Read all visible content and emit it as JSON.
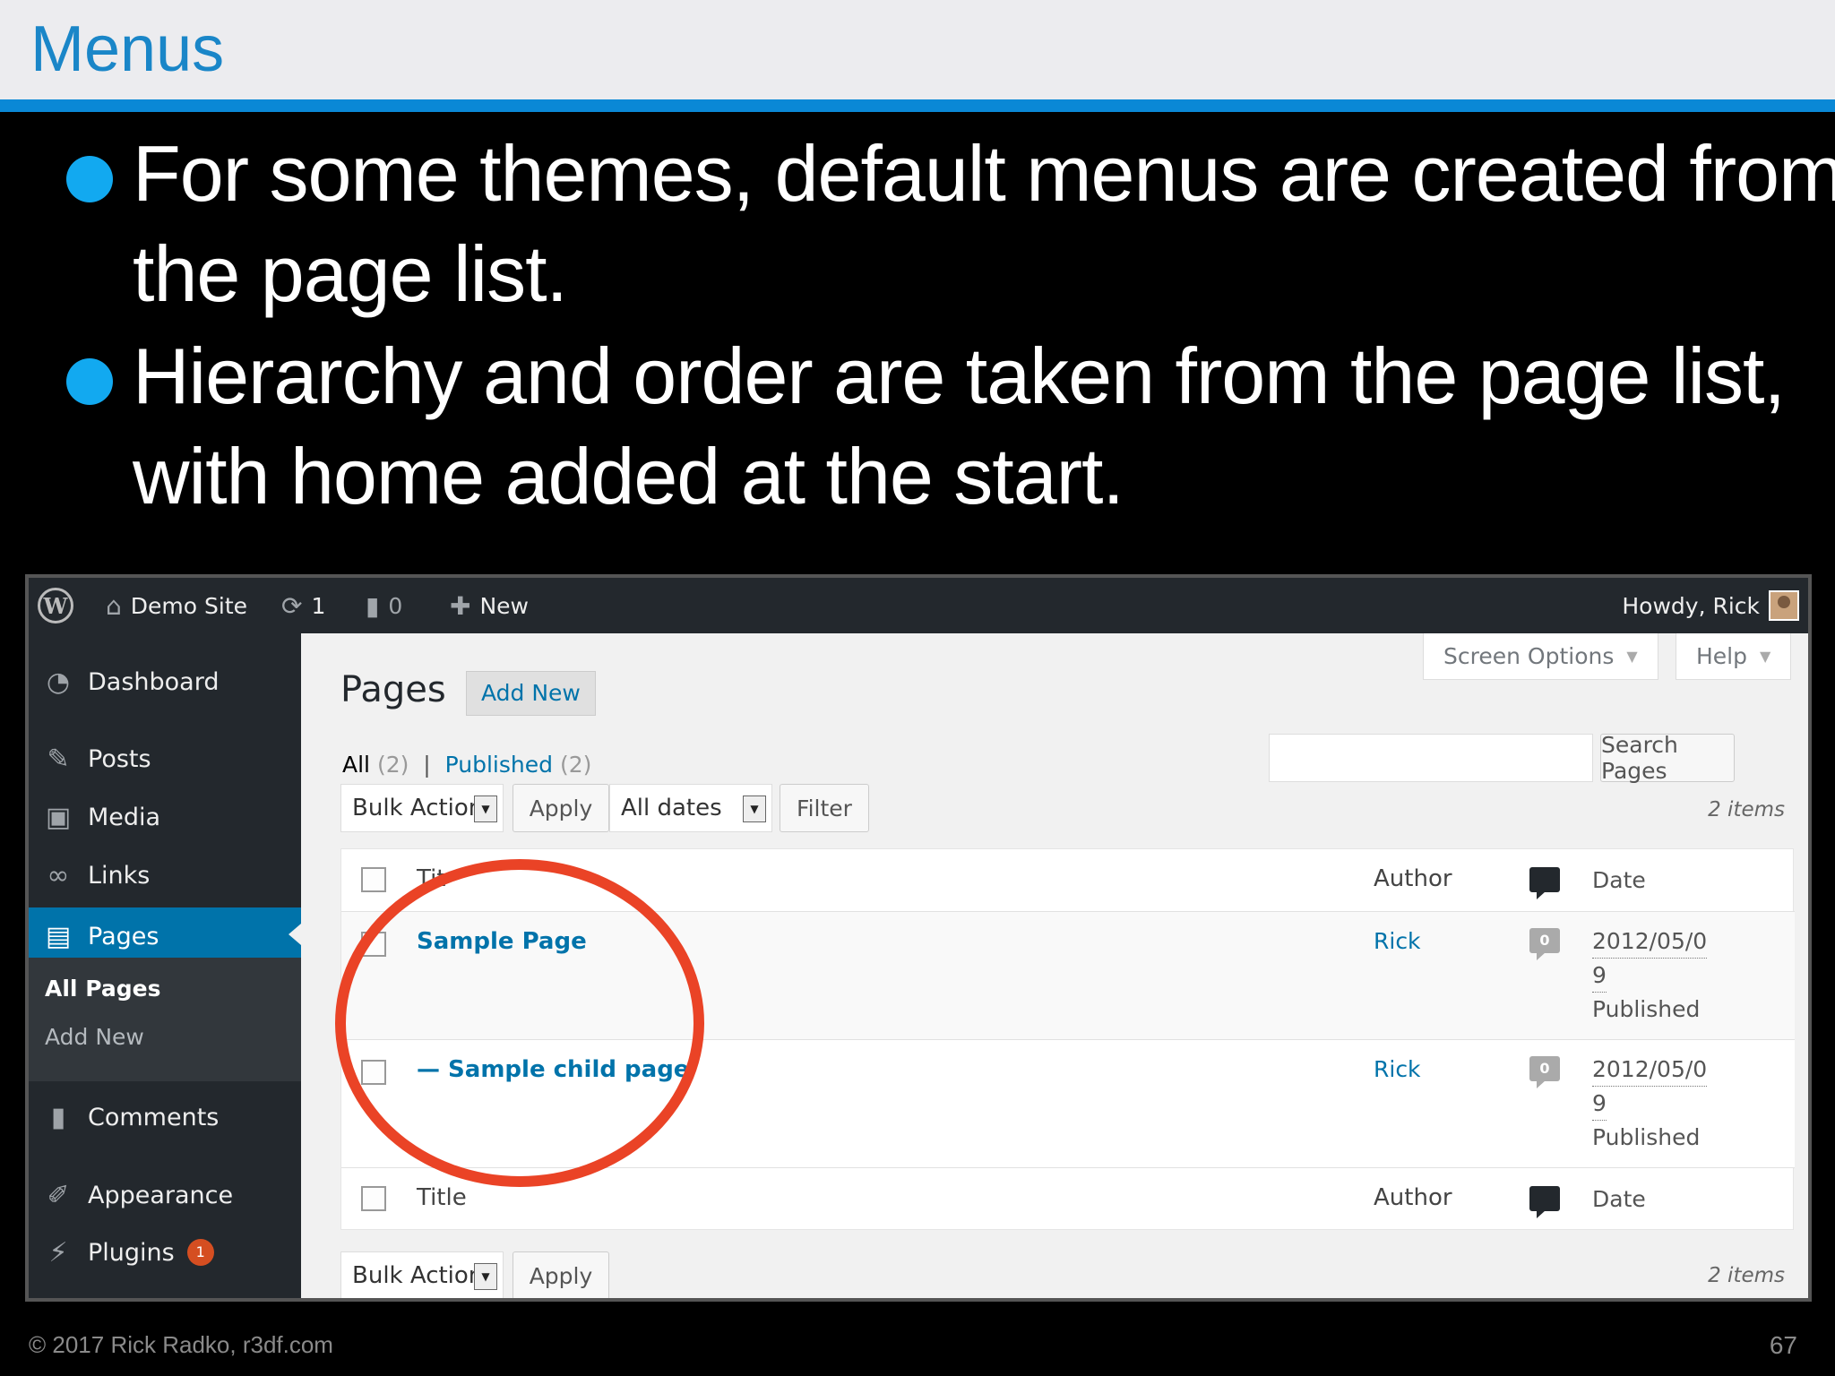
{
  "slide": {
    "title": "Menus",
    "bullets": [
      "For some themes, default menus are created from the page list.",
      "Hierarchy and order are taken from the page list, with home added at the start."
    ],
    "footer_left": "© 2017 Rick Radko, r3df.com",
    "page_number": "67",
    "accent_color": "#0a88d6",
    "bullet_color": "#12a9f0",
    "annotation_color": "#ea4326"
  },
  "adminbar": {
    "site_name": "Demo Site",
    "updates_count": "1",
    "comments_count": "0",
    "new_label": "New",
    "howdy": "Howdy, Rick",
    "icons": [
      "wordpress-icon",
      "home-icon",
      "update-icon",
      "comment-icon",
      "plus-icon"
    ]
  },
  "sidebar": {
    "items": [
      {
        "label": "Dashboard",
        "icon": "dashboard-icon"
      },
      {
        "label": "Posts",
        "icon": "pin-icon"
      },
      {
        "label": "Media",
        "icon": "media-icon"
      },
      {
        "label": "Links",
        "icon": "link-icon"
      },
      {
        "label": "Pages",
        "icon": "pages-icon",
        "current": true
      },
      {
        "label": "Comments",
        "icon": "comment-icon"
      },
      {
        "label": "Appearance",
        "icon": "brush-icon"
      },
      {
        "label": "Plugins",
        "icon": "plugin-icon",
        "badge": "1"
      }
    ],
    "submenu": [
      "All Pages",
      "Add New"
    ]
  },
  "main": {
    "title": "Pages",
    "add_new": "Add New",
    "screen_options": "Screen Options",
    "help": "Help",
    "filters": {
      "all_label": "All",
      "all_count": "(2)",
      "separator": "|",
      "published_label": "Published",
      "published_count": "(2)"
    },
    "search_button": "Search Pages",
    "search_value": "",
    "bulk_actions": "Bulk Actions",
    "apply": "Apply",
    "all_dates": "All dates",
    "filter": "Filter",
    "items_count": "2 items",
    "columns": {
      "title": "Title",
      "title_obscured": "Tit",
      "author": "Author",
      "date": "Date"
    },
    "rows": [
      {
        "title": "Sample Page",
        "author": "Rick",
        "comments": "0",
        "date_line1": "2012/05/0",
        "date_line2": "9",
        "status": "Published"
      },
      {
        "title": "— Sample child page",
        "author": "Rick",
        "comments": "0",
        "date_line1": "2012/05/0",
        "date_line2": "9",
        "status": "Published"
      }
    ]
  }
}
